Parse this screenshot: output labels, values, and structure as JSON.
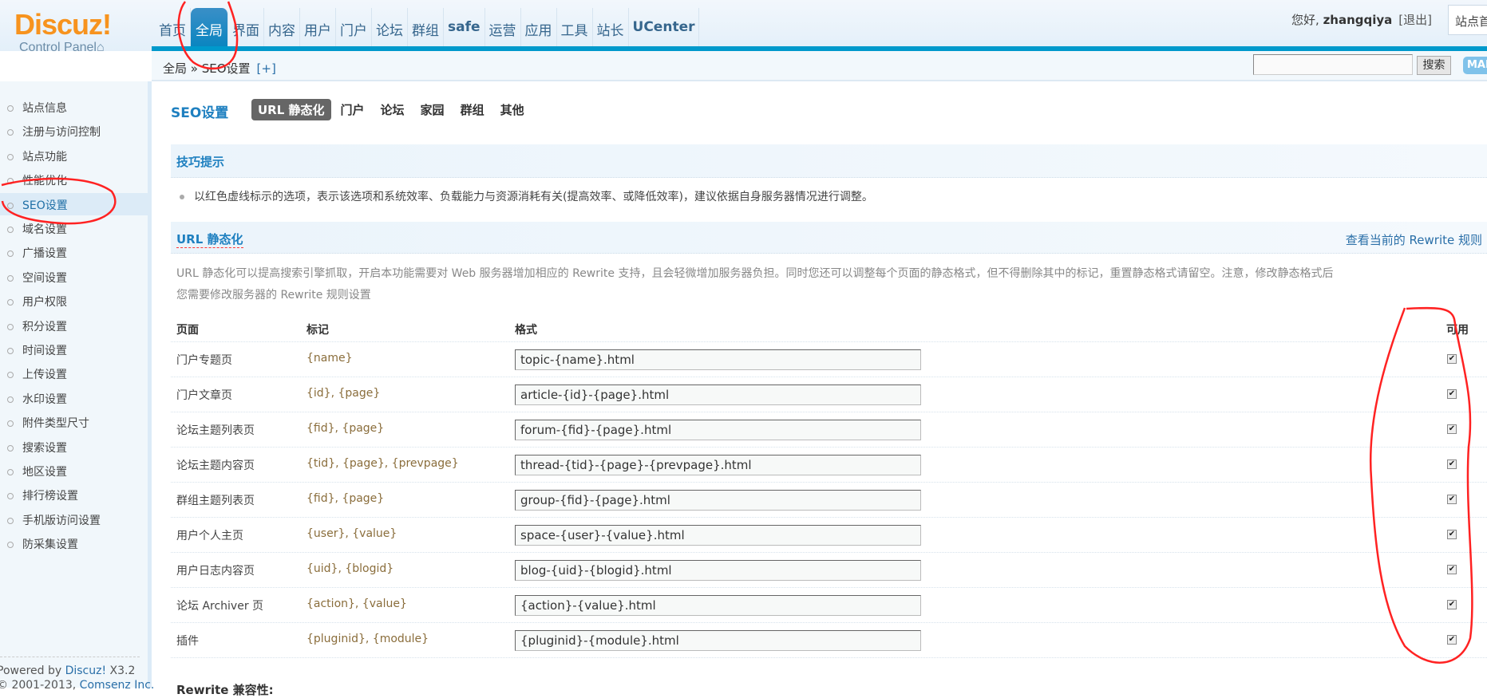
{
  "header": {
    "logo_text": "Discuz!",
    "logo_sub": "Control Panel",
    "nav": [
      "首页",
      "全局",
      "界面",
      "内容",
      "用户",
      "门户",
      "论坛",
      "群组",
      "safe",
      "运营",
      "应用",
      "工具",
      "站长",
      "UCenter"
    ],
    "nav_active": "全局",
    "greeting": "您好,",
    "username": "zhangqiya",
    "logout": "[退出]",
    "site_home": "站点首页"
  },
  "breadcrumb": {
    "path": "全局 » SEO设置",
    "add": "[+]"
  },
  "search": {
    "value": "",
    "button": "搜索",
    "badge": "MAP"
  },
  "sidebar": {
    "items": [
      "站点信息",
      "注册与访问控制",
      "站点功能",
      "性能优化",
      "SEO设置",
      "域名设置",
      "广播设置",
      "空间设置",
      "用户权限",
      "积分设置",
      "时间设置",
      "上传设置",
      "水印设置",
      "附件类型尺寸",
      "搜索设置",
      "地区设置",
      "排行榜设置",
      "手机版访问设置",
      "防采集设置"
    ],
    "active": "SEO设置",
    "powered_prefix": "Powered by ",
    "powered_link": "Discuz!",
    "powered_version": " X3.2",
    "copyright_prefix": "© 2001-2013, ",
    "copyright_link": "Comsenz Inc."
  },
  "main": {
    "title": "SEO设置",
    "tabs": [
      "URL 静态化",
      "门户",
      "论坛",
      "家园",
      "群组",
      "其他"
    ],
    "active_tab": "URL 静态化",
    "tips_title": "技巧提示",
    "tips_text": "以红色虚线标示的选项，表示该选项和系统效率、负载能力与资源消耗有关(提高效率、或降低效率)，建议依据自身服务器情况进行调整。",
    "section_title": "URL 静态化",
    "rewrite_link": "查看当前的 Rewrite 规则",
    "description_1": "URL 静态化可以提高搜索引擎抓取，开启本功能需要对 Web 服务器增加相应的 Rewrite 支持，且会轻微增加服务器负担。同时您还可以调整每个页面的静态格式，但不得删除其中的标记，重置静态格式请留空。注意，修改静态格式后",
    "description_2": "您需要修改服务器的 Rewrite 规则设置",
    "columns": [
      "页面",
      "标记",
      "格式",
      "可用"
    ],
    "rows": [
      {
        "page": "门户专题页",
        "tags": "{name}",
        "format": "topic-{name}.html",
        "enabled": true
      },
      {
        "page": "门户文章页",
        "tags": "{id}, {page}",
        "format": "article-{id}-{page}.html",
        "enabled": true
      },
      {
        "page": "论坛主题列表页",
        "tags": "{fid}, {page}",
        "format": "forum-{fid}-{page}.html",
        "enabled": true
      },
      {
        "page": "论坛主题内容页",
        "tags": "{tid}, {page}, {prevpage}",
        "format": "thread-{tid}-{page}-{prevpage}.html",
        "enabled": true
      },
      {
        "page": "群组主题列表页",
        "tags": "{fid}, {page}",
        "format": "group-{fid}-{page}.html",
        "enabled": true
      },
      {
        "page": "用户个人主页",
        "tags": "{user}, {value}",
        "format": "space-{user}-{value}.html",
        "enabled": true
      },
      {
        "page": "用户日志内容页",
        "tags": "{uid}, {blogid}",
        "format": "blog-{uid}-{blogid}.html",
        "enabled": true
      },
      {
        "page": "论坛 Archiver 页",
        "tags": "{action}, {value}",
        "format": "{action}-{value}.html",
        "enabled": true
      },
      {
        "page": "插件",
        "tags": "{pluginid}, {module}",
        "format": "{pluginid}-{module}.html",
        "enabled": true
      }
    ],
    "compat_label": "Rewrite 兼容性:"
  },
  "colors": {
    "accent": "#0099cc",
    "title_blue": "#1f80c0",
    "logo_orange": "#f7931e",
    "annotation_red": "#ff0000"
  }
}
